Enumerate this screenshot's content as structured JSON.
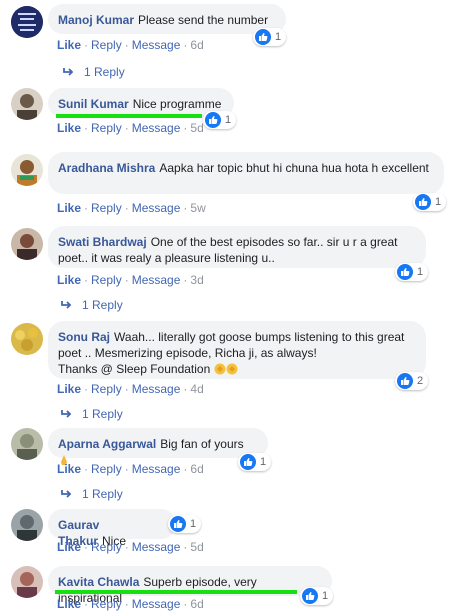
{
  "comments": [
    {
      "name": "Manoj Kumar",
      "text": "Please send the number",
      "like": "Like",
      "reply": "Reply",
      "message": "Message",
      "time": "6d",
      "reactions": "1",
      "reply_count": "1 Reply",
      "avatar_bg": "#1f2b66"
    },
    {
      "name": "Sunil Kumar",
      "text": "Nice programme",
      "like": "Like",
      "reply": "Reply",
      "message": "Message",
      "time": "5d",
      "reactions": "1",
      "avatar_bg": "#6b5a4a"
    },
    {
      "name": "Aradhana Mishra",
      "text": "Aapka har topic bhut hi chuna hua hota h excellent",
      "like": "Like",
      "reply": "Reply",
      "message": "Message",
      "time": "5w",
      "reactions": "1",
      "avatar_bg": "#c07a2c"
    },
    {
      "name": "Swati Bhardwaj",
      "text": "One of the best episodes so far.. sir u r a great poet.. it was realy a pleasure listening u..",
      "like": "Like",
      "reply": "Reply",
      "message": "Message",
      "time": "3d",
      "reactions": "1",
      "reply_count": "1 Reply",
      "avatar_bg": "#7a4b3a"
    },
    {
      "name": "Sonu Raj",
      "text": "Waah... literally got goose bumps listening to this great poet .. Mesmerizing episode, Richa ji, as always!",
      "text2": "Thanks @ Sleep Foundation",
      "like": "Like",
      "reply": "Reply",
      "message": "Message",
      "time": "4d",
      "reactions": "2",
      "reply_count": "1 Reply",
      "avatar_bg": "#d9b94a"
    },
    {
      "name": "Aparna Aggarwal",
      "text": "Big fan of yours",
      "like": "Like",
      "reply": "Reply",
      "message": "Message",
      "time": "6d",
      "reactions": "1",
      "reply_count": "1 Reply",
      "avatar_bg": "#8a8f7a"
    },
    {
      "name": "Gaurav Thakur",
      "text": "Nice",
      "like": "Like",
      "reply": "Reply",
      "message": "Message",
      "time": "5d",
      "reactions": "1",
      "avatar_bg": "#5e6a6e"
    },
    {
      "name": "Kavita Chawla",
      "text": "Superb episode, very inspirational",
      "like": "Like",
      "reply": "Reply",
      "message": "Message",
      "time": "6d",
      "reactions": "1",
      "avatar_bg": "#a6655a"
    }
  ],
  "colors": {
    "link": "#4267b2",
    "name": "#385898",
    "bubble": "#f2f3f5",
    "highlight": "#16e010",
    "like_badge": "#1877f2"
  }
}
